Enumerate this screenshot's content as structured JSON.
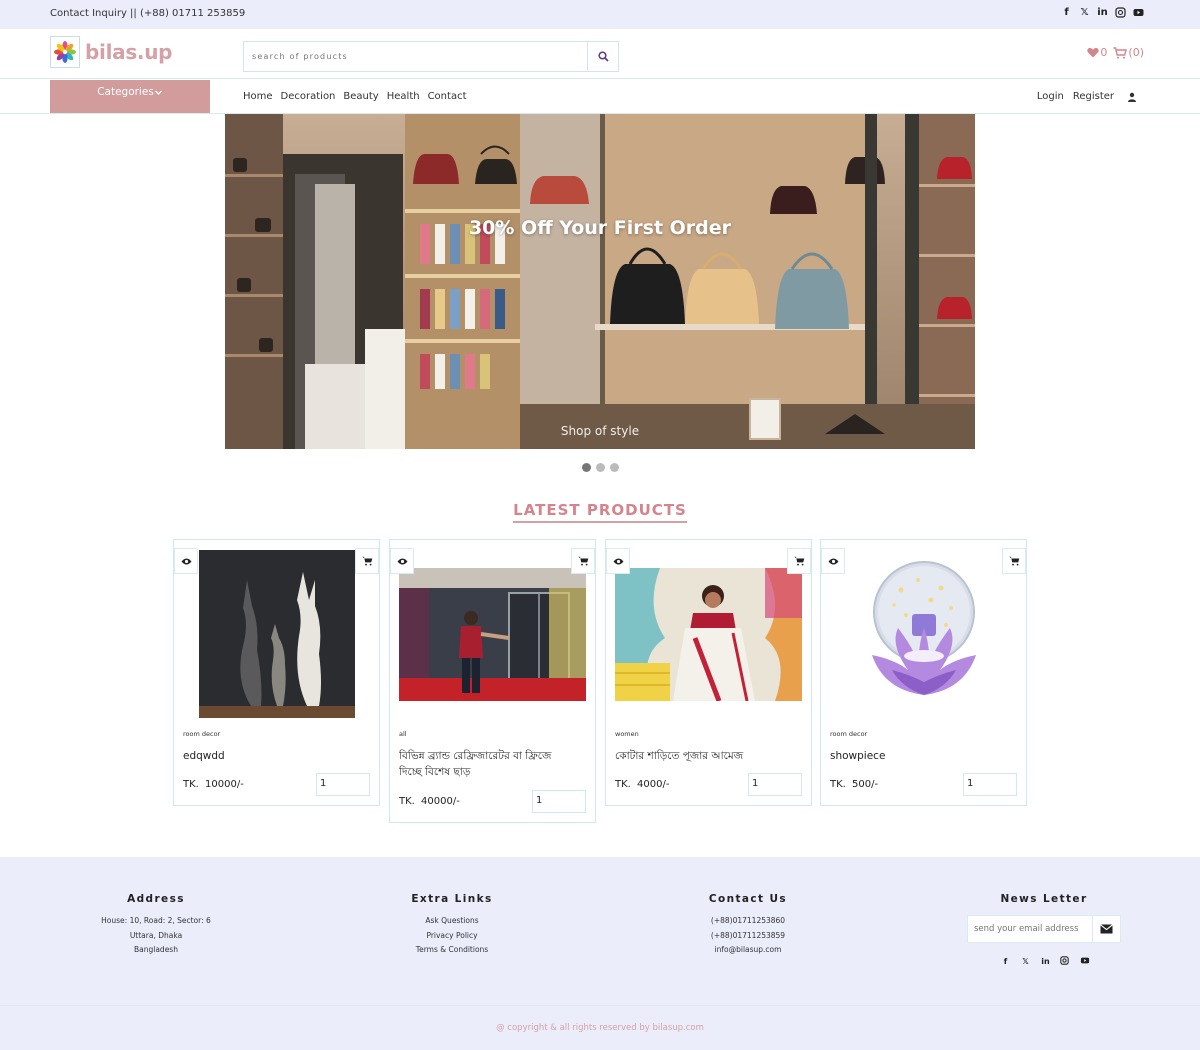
{
  "topbar": {
    "contact": "Contact Inquiry || (+88) 01711 253859",
    "socials": [
      "facebook-icon",
      "x-icon",
      "linkedin-icon",
      "instagram-icon",
      "youtube-icon"
    ]
  },
  "header": {
    "logo_text": "bilas.up",
    "search_placeholder": "search of products",
    "wishlist_count": "0",
    "cart_count": "(0)"
  },
  "nav": {
    "categories_label": "Categories",
    "links": [
      "Home",
      "Decoration",
      "Beauty",
      "Health",
      "Contact"
    ],
    "login": "Login",
    "register": "Register"
  },
  "hero": {
    "title": "30% Off Your First Order",
    "subtitle": "Shop of style",
    "slides": 3,
    "active_slide": 1
  },
  "products_section": {
    "title": "LATEST PRODUCTS",
    "items": [
      {
        "category": "room decor",
        "name": "edqwdd",
        "currency": "TK.",
        "price": "10000/-",
        "qty": "1"
      },
      {
        "category": "all",
        "name": "বিভিন্ন ব্র্যান্ড রেফ্রিজারেটর বা ফ্রিজে দিচ্ছে বিশেষ ছাড়",
        "currency": "TK.",
        "price": "40000/-",
        "qty": "1"
      },
      {
        "category": "women",
        "name": "কোটার শাড়িতে পূজার আমেজ",
        "currency": "TK.",
        "price": "4000/-",
        "qty": "1"
      },
      {
        "category": "room decor",
        "name": "showpiece",
        "currency": "TK.",
        "price": "500/-",
        "qty": "1"
      }
    ]
  },
  "footer": {
    "address": {
      "title": "Address",
      "lines": [
        "House: 10, Road: 2, Sector: 6",
        "Uttara, Dhaka",
        "Bangladesh"
      ]
    },
    "extra_links": {
      "title": "Extra Links",
      "lines": [
        "Ask Questions",
        "Privacy Policy",
        "Terms & Conditions"
      ]
    },
    "contact": {
      "title": "Contact Us",
      "lines": [
        "(+88)01711253860",
        "(+88)01711253859",
        "info@bilasup.com"
      ]
    },
    "newsletter": {
      "title": "News Letter",
      "placeholder": "send your email address"
    },
    "copyright": "@ copyright & all rights reserved by bilasup.com"
  },
  "colors": {
    "accent": "#d4a1a6",
    "category_button": "#d29c9c",
    "footer_bg": "#ebedfb",
    "border": "#cfeaef"
  }
}
